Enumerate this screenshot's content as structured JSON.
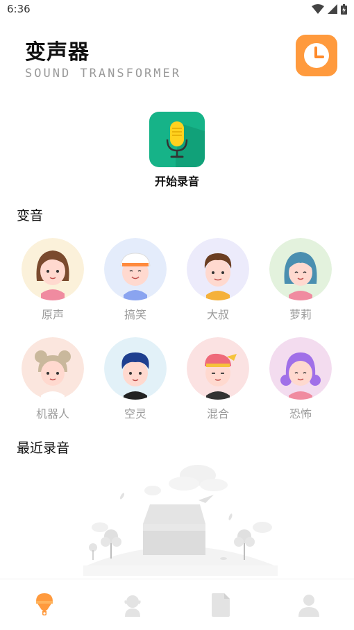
{
  "status_bar": {
    "time": "6:36",
    "icons": [
      "wifi-icon",
      "signal-icon",
      "battery-icon"
    ]
  },
  "header": {
    "title": "变声器",
    "subtitle": "SOUND TRANSFORMER",
    "history_icon": "clock-icon",
    "accent_color": "#ff9a3d"
  },
  "record": {
    "label": "开始录音",
    "icon": "microphone-icon",
    "tile_color": "#16b388"
  },
  "voice_section": {
    "title": "变音",
    "items": [
      {
        "label": "原声"
      },
      {
        "label": "搞笑"
      },
      {
        "label": "大叔"
      },
      {
        "label": "萝莉"
      },
      {
        "label": "机器人"
      },
      {
        "label": "空灵"
      },
      {
        "label": "混合"
      },
      {
        "label": "恐怖"
      }
    ]
  },
  "recent_section": {
    "title": "最近录音"
  },
  "bottom_nav": {
    "active_color": "#ff9a3d",
    "tabs": [
      {
        "icon": "microphone-icon",
        "active": true
      },
      {
        "icon": "person-voice-icon",
        "active": false
      },
      {
        "icon": "document-icon",
        "active": false
      },
      {
        "icon": "user-icon",
        "active": false
      }
    ]
  }
}
